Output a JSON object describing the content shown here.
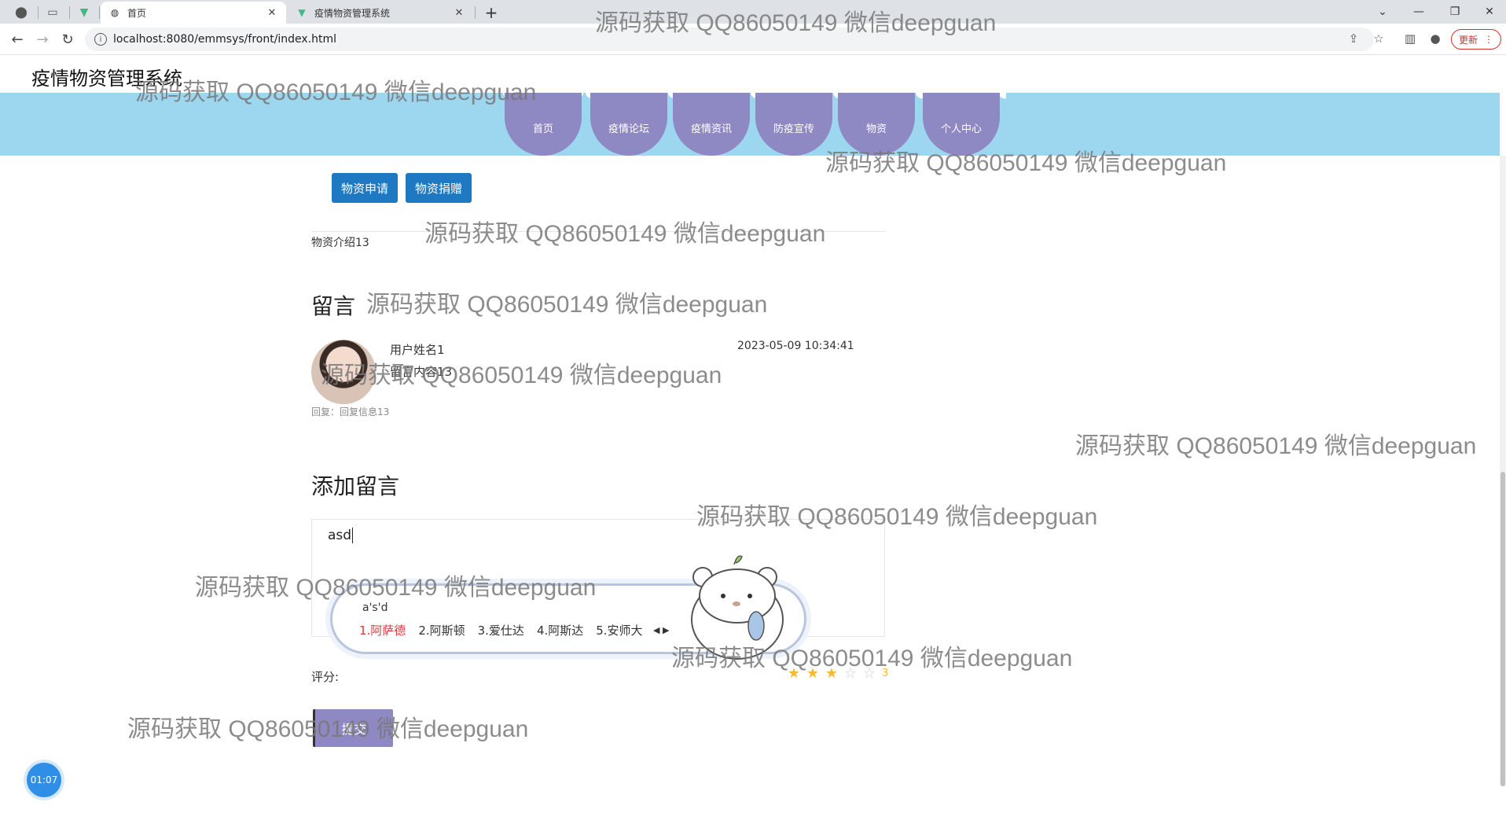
{
  "browser": {
    "tabs": [
      {
        "title": "首页",
        "favicon": "globe-icon",
        "active": true
      },
      {
        "title": "疫情物资管理系统",
        "favicon": "vue-icon",
        "active": false
      }
    ],
    "close_glyph": "✕",
    "new_tab_glyph": "+",
    "url": "localhost:8080/emmsys/front/index.html",
    "update_label": "更新",
    "window_controls": [
      "⌄",
      "—",
      "❐",
      "✕"
    ]
  },
  "site": {
    "title": "疫情物资管理系统",
    "nav": [
      "首页",
      "疫情论坛",
      "疫情资讯",
      "防疫宣传",
      "物资",
      "个人中心"
    ],
    "nav_color": "#8e88c3",
    "band_color": "#9cd6ef"
  },
  "detail": {
    "apply_label": "物资申请",
    "donate_label": "物资捐赠",
    "intro": "物资介绍13",
    "accent": "#1e79c2"
  },
  "comments": {
    "title": "留言",
    "items": [
      {
        "user": "用户姓名1",
        "time": "2023-05-09 10:34:41",
        "content": "留言内容13",
        "reply": "回复：回复信息13"
      }
    ]
  },
  "add_comment": {
    "title": "添加留言",
    "input_value": "asd",
    "rating_label": "评分:",
    "rating": 3,
    "rating_max": 5,
    "rating_text": "3",
    "submit_label": "提交"
  },
  "ime": {
    "composition": "a's'd",
    "candidates": [
      "1.阿萨德",
      "2.阿斯顿",
      "3.爱仕达",
      "4.阿斯达",
      "5.安师大"
    ],
    "arrows": "◀ ▶"
  },
  "recording_timer": "01:07",
  "watermark": "源码获取 QQ86050149 微信deepguan"
}
